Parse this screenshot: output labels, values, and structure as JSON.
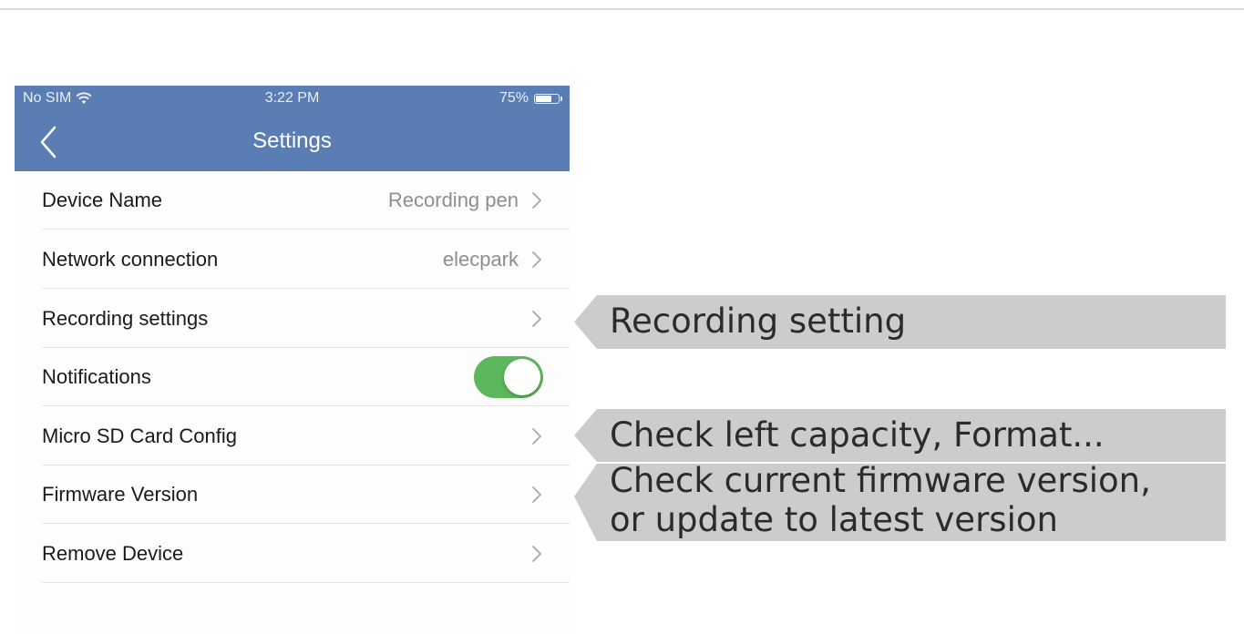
{
  "status_bar": {
    "carrier": "No SIM",
    "time": "3:22 PM",
    "battery_label": "75%",
    "battery_level": 0.75,
    "wifi_icon": "wifi-icon"
  },
  "header": {
    "title": "Settings",
    "back_icon": "chevron-left-icon",
    "background_color": "#5a7db3"
  },
  "settings": {
    "device_name": {
      "label": "Device Name",
      "value": "Recording pen"
    },
    "network": {
      "label": "Network connection",
      "value": "elecpark"
    },
    "recording": {
      "label": "Recording settings"
    },
    "notifications": {
      "label": "Notifications",
      "enabled": true,
      "toggle_color": "#5cb85c"
    },
    "sd_card": {
      "label": "Micro SD Card Config"
    },
    "firmware": {
      "label": "Firmware Version"
    },
    "remove": {
      "label": "Remove Device"
    }
  },
  "annotations": {
    "recording": "Recording setting",
    "sd_card": "Check left capacity, Format...",
    "firmware_line1": "Check current firmware version,",
    "firmware_line2": "or update to latest version",
    "callout_color": "#cccccc"
  }
}
